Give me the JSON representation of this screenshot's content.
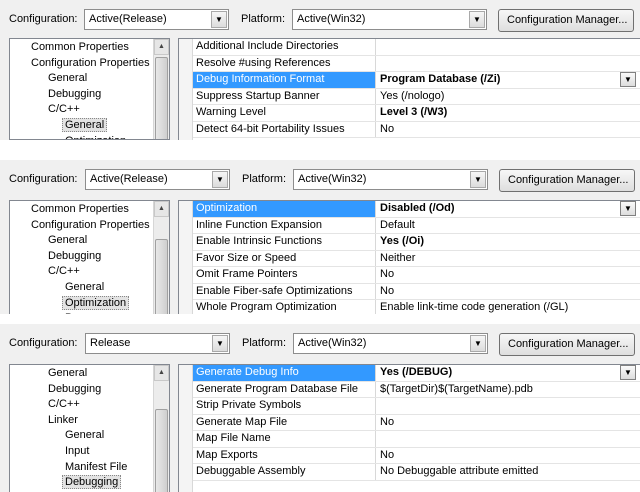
{
  "panels": [
    {
      "config_label": "Configuration:",
      "config_value": "Active(Release)",
      "platform_label": "Platform:",
      "platform_value": "Active(Win32)",
      "config_manager_label": "Configuration Manager...",
      "tree": [
        {
          "label": "Common Properties",
          "indent": 1
        },
        {
          "label": "Configuration Properties",
          "indent": 1
        },
        {
          "label": "General",
          "indent": 2
        },
        {
          "label": "Debugging",
          "indent": 2
        },
        {
          "label": "C/C++",
          "indent": 2
        },
        {
          "label": "General",
          "indent": 3,
          "selected": true
        },
        {
          "label": "Optimization",
          "indent": 3
        }
      ],
      "rows": [
        {
          "name": "Additional Include Directories",
          "value": ""
        },
        {
          "name": "Resolve #using References",
          "value": ""
        },
        {
          "name": "Debug Information Format",
          "value": "Program Database (/Zi)",
          "selected": true,
          "bold": true
        },
        {
          "name": "Suppress Startup Banner",
          "value": "Yes (/nologo)"
        },
        {
          "name": "Warning Level",
          "value": "Level 3 (/W3)",
          "bold": true
        },
        {
          "name": "Detect 64-bit Portability Issues",
          "value": "No"
        }
      ]
    },
    {
      "config_label": "Configuration:",
      "config_value": "Active(Release)",
      "platform_label": "Platform:",
      "platform_value": "Active(Win32)",
      "config_manager_label": "Configuration Manager...",
      "tree": [
        {
          "label": "Common Properties",
          "indent": 1
        },
        {
          "label": "Configuration Properties",
          "indent": 1
        },
        {
          "label": "General",
          "indent": 2
        },
        {
          "label": "Debugging",
          "indent": 2
        },
        {
          "label": "C/C++",
          "indent": 2
        },
        {
          "label": "General",
          "indent": 3
        },
        {
          "label": "Optimization",
          "indent": 3,
          "selected": true
        },
        {
          "label": "Preprocessor",
          "indent": 3
        }
      ],
      "rows": [
        {
          "name": "Optimization",
          "value": "Disabled (/Od)",
          "selected": true,
          "bold": true
        },
        {
          "name": "Inline Function Expansion",
          "value": "Default"
        },
        {
          "name": "Enable Intrinsic Functions",
          "value": "Yes (/Oi)",
          "bold": true
        },
        {
          "name": "Favor Size or Speed",
          "value": "Neither"
        },
        {
          "name": "Omit Frame Pointers",
          "value": "No"
        },
        {
          "name": "Enable Fiber-safe Optimizations",
          "value": "No"
        },
        {
          "name": "Whole Program Optimization",
          "value": "Enable link-time code generation (/GL)"
        }
      ]
    },
    {
      "config_label": "Configuration:",
      "config_value": "Release",
      "platform_label": "Platform:",
      "platform_value": "Active(Win32)",
      "config_manager_label": "Configuration Manager...",
      "tree": [
        {
          "label": "General",
          "indent": 2
        },
        {
          "label": "Debugging",
          "indent": 2
        },
        {
          "label": "C/C++",
          "indent": 2
        },
        {
          "label": "Linker",
          "indent": 2
        },
        {
          "label": "General",
          "indent": 3
        },
        {
          "label": "Input",
          "indent": 3
        },
        {
          "label": "Manifest File",
          "indent": 3
        },
        {
          "label": "Debugging",
          "indent": 3,
          "selected": true
        }
      ],
      "rows": [
        {
          "name": "Generate Debug Info",
          "value": "Yes (/DEBUG)",
          "selected": true,
          "bold": true
        },
        {
          "name": "Generate Program Database File",
          "value": "$(TargetDir)$(TargetName).pdb"
        },
        {
          "name": "Strip Private Symbols",
          "value": ""
        },
        {
          "name": "Generate Map File",
          "value": "No"
        },
        {
          "name": "Map File Name",
          "value": ""
        },
        {
          "name": "Map Exports",
          "value": "No"
        },
        {
          "name": "Debuggable Assembly",
          "value": "No Debuggable attribute emitted"
        }
      ]
    }
  ]
}
